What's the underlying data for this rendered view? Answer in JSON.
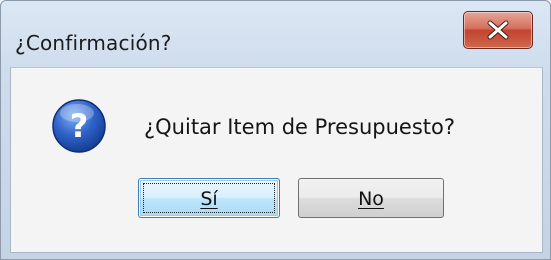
{
  "dialog": {
    "title": "¿Confirmación?",
    "message": "¿Quitar Item de Presupuesto?",
    "icon": "question-icon",
    "buttons": {
      "yes_label": "Sí",
      "no_label": "No"
    },
    "close_icon": "close-icon"
  },
  "colors": {
    "close_button": "#c94a37",
    "icon_blue": "#2456b8",
    "focused_button_border": "#3c7fb1"
  }
}
